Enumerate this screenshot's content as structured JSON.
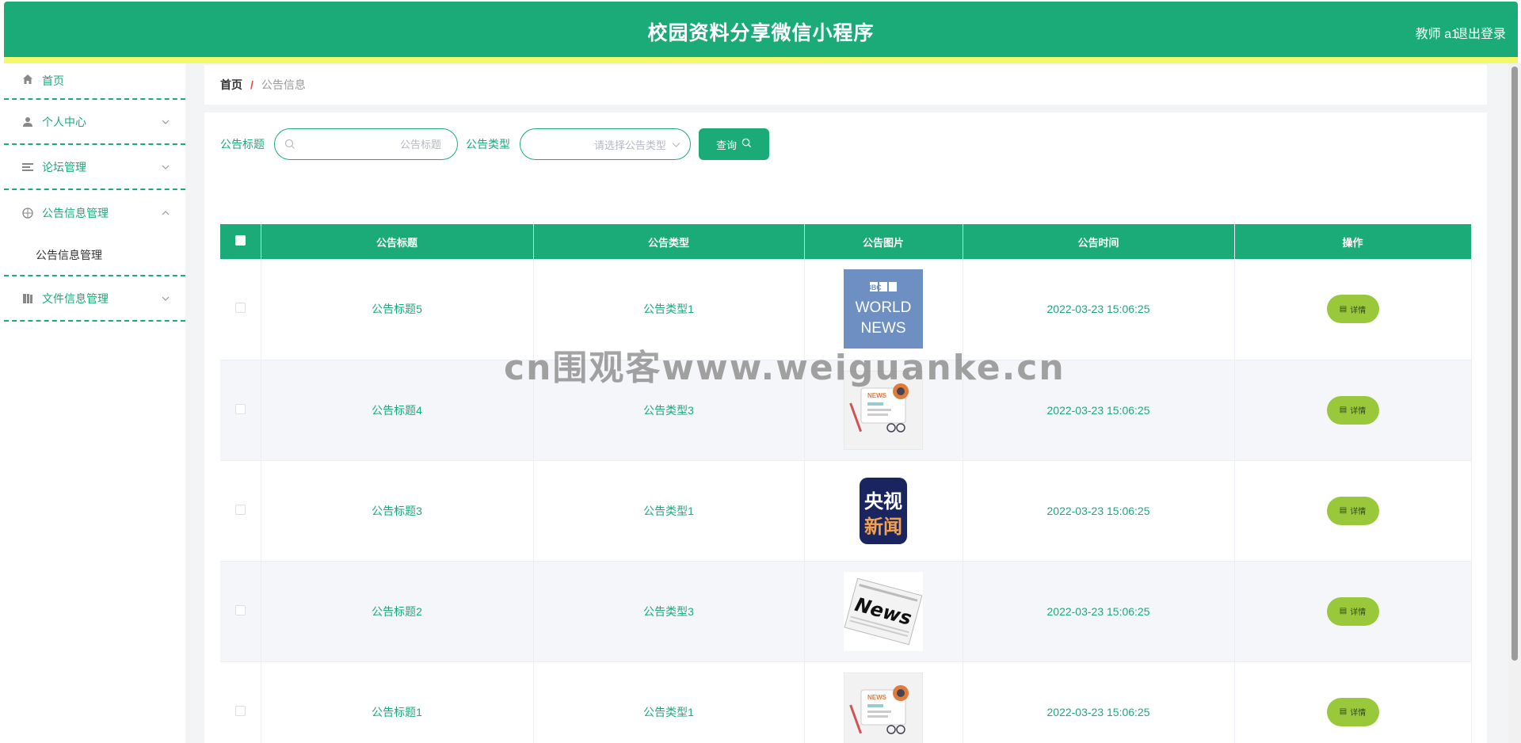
{
  "header": {
    "title": "校园资料分享微信小程序",
    "user": "教师 a1",
    "logout": "退出登录"
  },
  "sidebar": {
    "items": [
      {
        "label": "首页",
        "icon": "home-icon"
      },
      {
        "label": "个人中心",
        "icon": "user-icon"
      },
      {
        "label": "论坛管理",
        "icon": "list-icon"
      },
      {
        "label": "公告信息管理",
        "icon": "compass-icon",
        "expanded": true,
        "children": [
          {
            "label": "公告信息管理"
          }
        ]
      },
      {
        "label": "文件信息管理",
        "icon": "book-icon"
      }
    ]
  },
  "breadcrumb": {
    "home": "首页",
    "separator": "/",
    "current": "公告信息"
  },
  "search": {
    "title_label": "公告标题",
    "title_placeholder": "公告标题",
    "type_label": "公告类型",
    "type_placeholder": "请选择公告类型",
    "query_button": "查询"
  },
  "table": {
    "headers": [
      "公告标题",
      "公告类型",
      "公告图片",
      "公告时间",
      "操作"
    ],
    "detail_label": "详情",
    "rows": [
      {
        "title": "公告标题5",
        "type": "公告类型1",
        "image": "bbc-world-news",
        "time": "2022-03-23 15:06:25"
      },
      {
        "title": "公告标题4",
        "type": "公告类型3",
        "image": "news-illustration",
        "time": "2022-03-23 15:06:25"
      },
      {
        "title": "公告标题3",
        "type": "公告类型1",
        "image": "cctv-news",
        "time": "2022-03-23 15:06:25"
      },
      {
        "title": "公告标题2",
        "type": "公告类型3",
        "image": "newspaper",
        "time": "2022-03-23 15:06:25"
      },
      {
        "title": "公告标题1",
        "type": "公告类型1",
        "image": "news-illustration",
        "time": "2022-03-23 15:06:25"
      }
    ]
  },
  "watermark": "cn围观客www.weiguanke.cn",
  "thumb_text": {
    "bbc": "BBC",
    "world": "WORLD",
    "news": "NEWS",
    "cctv_1": "央视",
    "cctv_2": "新闻",
    "news_small": "NEWS",
    "news_paper": "News"
  },
  "colors": {
    "primary": "#1bab79",
    "accent_strip": "#f4f96a",
    "detail_button": "#99c93b"
  }
}
